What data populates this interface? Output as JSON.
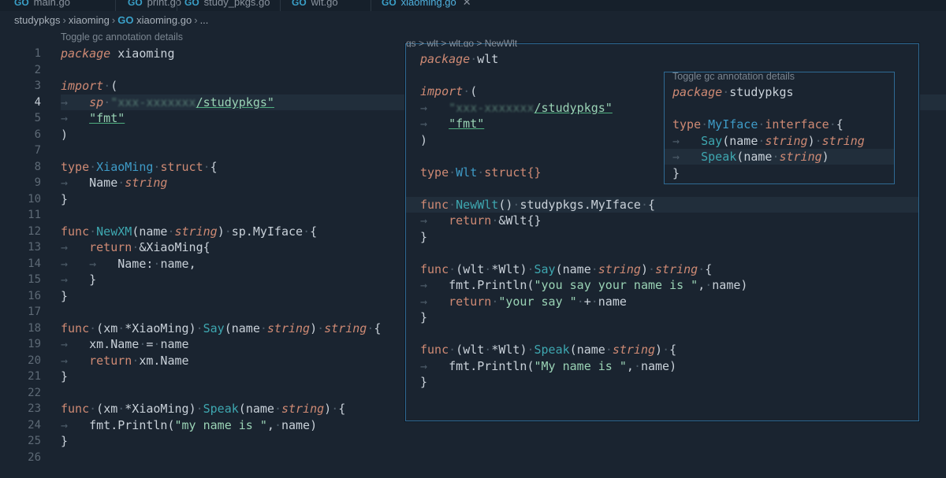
{
  "tabs": [
    {
      "label": "main.go",
      "active": false
    },
    {
      "label": "print.go",
      "active": false
    },
    {
      "label": "study_pkgs.go",
      "active": false
    },
    {
      "label": "wlt.go",
      "active": false
    },
    {
      "label": "xiaoming.go",
      "active": true
    }
  ],
  "icons": {
    "go_file": "go-file-icon",
    "close": "close-icon",
    "breadcrumb_sep": "chevron-right-icon",
    "symbol": "symbol-method-icon"
  },
  "breadcrumb": {
    "folder1": "studypkgs",
    "folder2": "xiaoming",
    "file": "xiaoming.go",
    "more": "..."
  },
  "codelens": {
    "main": "Toggle gc annotation details",
    "peek2": "Toggle gc annotation details"
  },
  "editor": {
    "current_line": 4,
    "line_numbers": [
      "1",
      "2",
      "3",
      "4",
      "5",
      "6",
      "7",
      "8",
      "9",
      "10",
      "11",
      "12",
      "13",
      "14",
      "15",
      "16",
      "17",
      "18",
      "19",
      "20",
      "21",
      "22",
      "23",
      "24",
      "25",
      "26"
    ]
  },
  "code": {
    "t_package": "package",
    "t_import": "import",
    "t_type": "type",
    "t_struct": "struct",
    "t_func": "func",
    "t_return": "return",
    "t_interface": "interface",
    "t_string": "string",
    "m_pkgname": "xiaoming",
    "m_alias": "sp",
    "m_import_blur": "\"xxx-xxxxxxx",
    "m_import_path": "/studypkgs\"",
    "m_fmt": "\"fmt\"",
    "m_XiaoMing": "XiaoMing",
    "m_Name": "Name",
    "m_NewXM": "NewXM",
    "m_name": "name",
    "m_spMyIface": "sp.MyIface",
    "m_Name_colon": "Name:",
    "m_xm": "xm",
    "m_star_XiaoMing": "*XiaoMing",
    "m_Say": "Say",
    "m_Speak": "Speak",
    "m_xm_Name": "xm.Name",
    "m_println": "fmt.Println",
    "m_str_myname": "\"my name is \"",
    "m_amp_XiaoMing": "&XiaoMing"
  },
  "peek1": {
    "breadcrumb": "gs > wlt > wlt.go > NewWlt",
    "pkgname": "wlt",
    "type_name": "Wlt",
    "struct_empty": "struct{}",
    "newwlt": "NewWlt",
    "studypkgs_iface": "studypkgs.MyIface",
    "amp_wlt": "&Wlt{}",
    "recv": "wlt",
    "recv_type": "*Wlt",
    "str_yousay": "\"you say your name is \"",
    "str_yoursay": "\"your say \"",
    "str_myname": "\"My name is \""
  },
  "peek2": {
    "pkgname": "studypkgs",
    "iface": "MyIface"
  }
}
